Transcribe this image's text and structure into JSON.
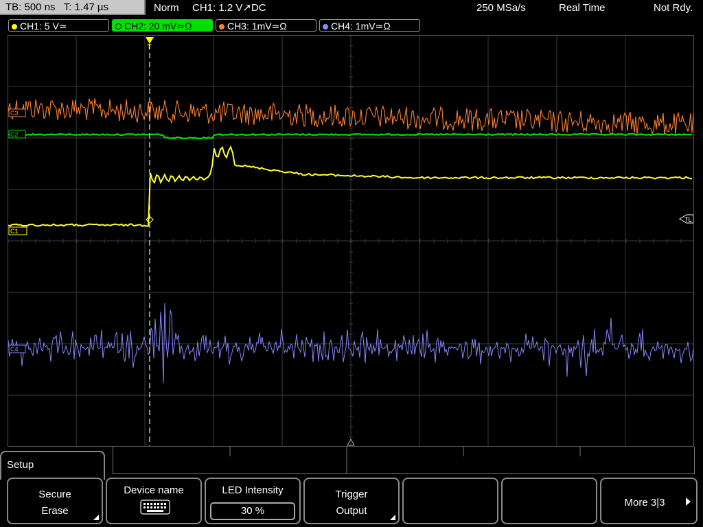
{
  "status_bar": {
    "timebase": "TB: 500 ns",
    "trigger_time": "T: 1.47 µs",
    "mode": "Norm",
    "trigger_source": "CH1: 1.2 V",
    "trigger_edge": "↗",
    "coupling": "DC",
    "sample_rate": "250 MSa/s",
    "acq_mode": "Real Time",
    "status": "Not Rdy."
  },
  "channels": [
    {
      "label": "CH1: 5 V≃",
      "color": "#ffff00",
      "active": false
    },
    {
      "label": "CH2: 20 mV≃Ω",
      "color": "#00e000",
      "active": true
    },
    {
      "label": "CH3: 1mV≃Ω",
      "color": "#ff8030",
      "active": false
    },
    {
      "label": "CH4: 1mV≃Ω",
      "color": "#8888ff",
      "active": false
    }
  ],
  "markers": {
    "trigger_top": "T",
    "ch1_marker": "C1",
    "trigger_level": "TL",
    "ch2_marker": "C2",
    "ch3_marker": "C3",
    "ch4_marker": "C4"
  },
  "menu": {
    "title": "Setup",
    "softkeys": [
      {
        "line1": "Secure",
        "line2": "Erase"
      },
      {
        "line1": "Device name",
        "icon": "keyboard-icon"
      },
      {
        "line1": "LED Intensity",
        "value": "30 %"
      },
      {
        "line1": "Trigger",
        "line2": "Output"
      },
      {
        "line1": ""
      },
      {
        "line1": ""
      },
      {
        "line1": "More 3|3"
      }
    ]
  }
}
